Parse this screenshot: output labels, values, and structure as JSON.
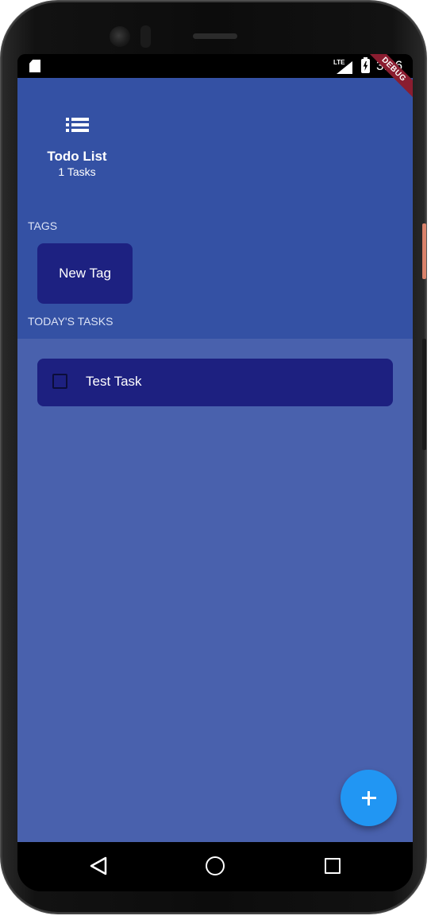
{
  "status_bar": {
    "network": "LTE",
    "time": "3:16"
  },
  "debug_banner": "DEBUG",
  "header": {
    "title": "Todo List",
    "task_count": "1 Tasks"
  },
  "tags": {
    "section_label": "TAGS",
    "items": [
      {
        "label": "New Tag"
      }
    ]
  },
  "today": {
    "section_label": "TODAY'S TASKS",
    "tasks": [
      {
        "label": "Test Task",
        "checked": false
      }
    ]
  },
  "fab": {
    "icon": "add-icon"
  },
  "colors": {
    "header_bg": "#3451a4",
    "body_bg": "#4961ad",
    "card_bg": "#1d2181",
    "fab_bg": "#2196f3",
    "debug_ribbon": "#8a1d30"
  },
  "icons": {
    "header": "list-icon",
    "nav_back": "back-icon",
    "nav_home": "home-icon",
    "nav_recents": "recents-icon"
  }
}
